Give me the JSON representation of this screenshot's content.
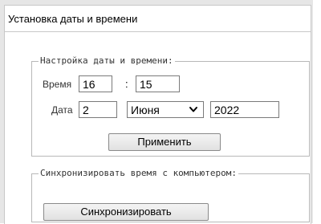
{
  "panel": {
    "title": "Установка даты и времени"
  },
  "datetime_section": {
    "legend": "Настройка даты и времени:",
    "time_label": "Время",
    "hours_value": "16",
    "separator": ":",
    "minutes_value": "15",
    "date_label": "Дата",
    "day_value": "2",
    "month_selected": "Июня",
    "year_value": "2022",
    "apply_label": "Применить"
  },
  "sync_section": {
    "legend": "Синхронизировать время с компьютером:",
    "sync_label": "Синхронизировать"
  },
  "icons": {
    "month_dropdown": "chevron-down-icon"
  },
  "colors": {
    "background": "#e6e6e6",
    "panel": "#ffffff",
    "border": "#b8b8b8"
  }
}
